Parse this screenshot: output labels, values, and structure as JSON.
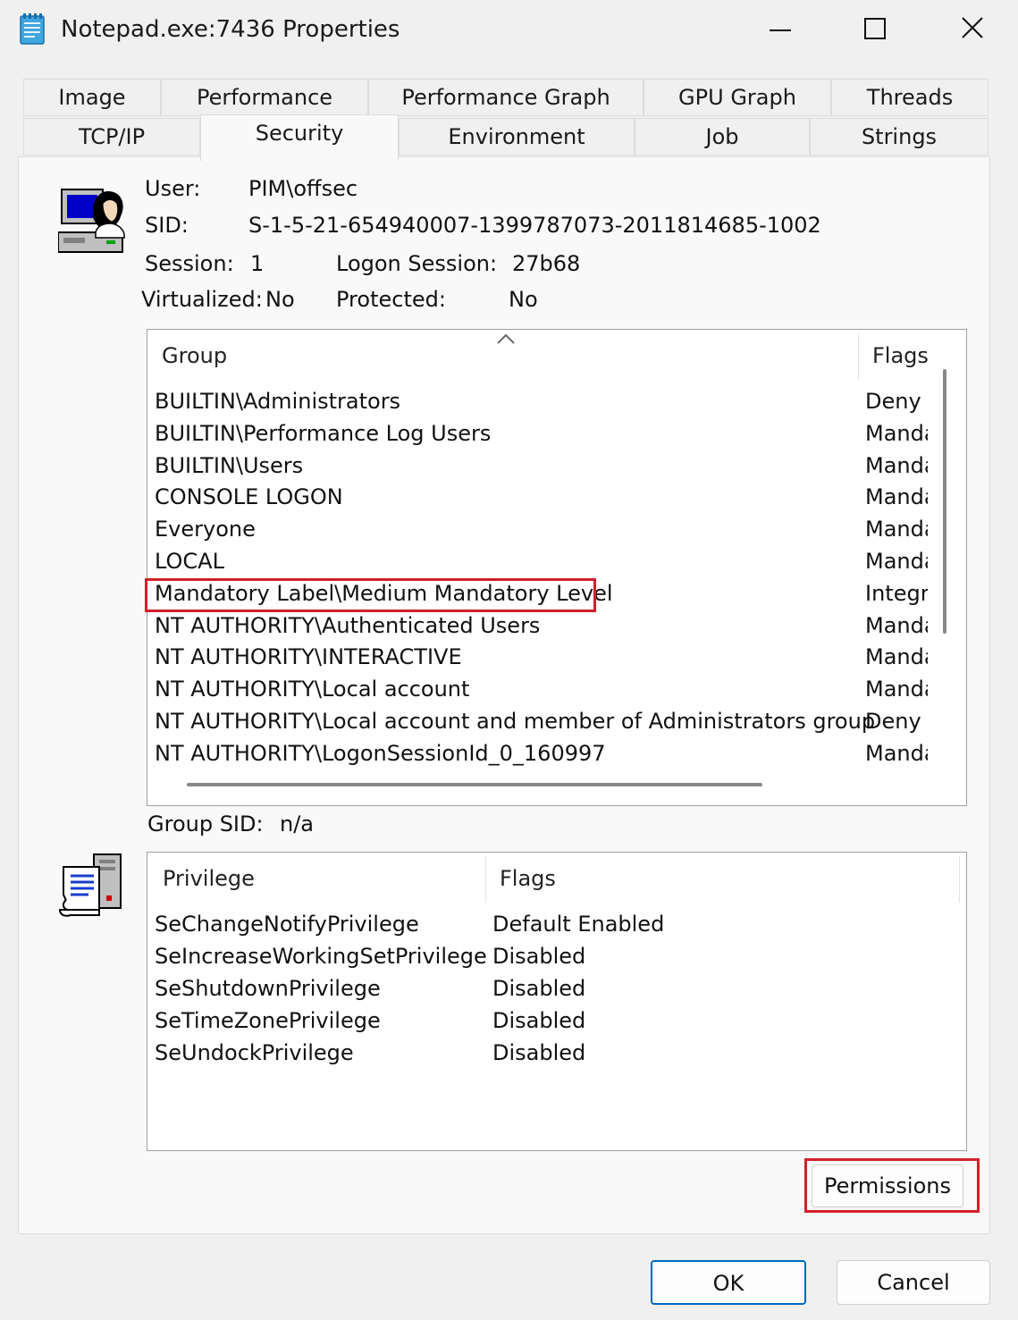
{
  "window": {
    "title": "Notepad.exe:7436 Properties"
  },
  "tabs": {
    "row1": [
      "Image",
      "Performance",
      "Performance Graph",
      "GPU Graph",
      "Threads"
    ],
    "row2": [
      "TCP/IP",
      "Security",
      "Environment",
      "Job",
      "Strings"
    ],
    "active": "Security"
  },
  "identity": {
    "user_label": "User:",
    "user_value": "PIM\\offsec",
    "sid_label": "SID:",
    "sid_value": "S-1-5-21-654940007-1399787073-2011814685-1002",
    "session_label": "Session:",
    "session_value": "1",
    "logon_session_label": "Logon Session:",
    "logon_session_value": "27b68",
    "virtualized_label": "Virtualized:",
    "virtualized_value": "No",
    "protected_label": "Protected:",
    "protected_value": "No"
  },
  "groups": {
    "columns": [
      "Group",
      "Flags"
    ],
    "rows": [
      {
        "group": "BUILTIN\\Administrators",
        "flags": "Deny"
      },
      {
        "group": "BUILTIN\\Performance Log Users",
        "flags": "Manda"
      },
      {
        "group": "BUILTIN\\Users",
        "flags": "Manda"
      },
      {
        "group": "CONSOLE LOGON",
        "flags": "Manda"
      },
      {
        "group": "Everyone",
        "flags": "Manda"
      },
      {
        "group": "LOCAL",
        "flags": "Manda"
      },
      {
        "group": "Mandatory Label\\Medium Mandatory Level",
        "flags": "Integri"
      },
      {
        "group": "NT AUTHORITY\\Authenticated Users",
        "flags": "Manda"
      },
      {
        "group": "NT AUTHORITY\\INTERACTIVE",
        "flags": "Manda"
      },
      {
        "group": "NT AUTHORITY\\Local account",
        "flags": "Manda"
      },
      {
        "group": "NT AUTHORITY\\Local account and member of Administrators group",
        "flags": "Deny"
      },
      {
        "group": "NT AUTHORITY\\LogonSessionId_0_160997",
        "flags": "Manda"
      }
    ]
  },
  "group_sid": {
    "label": "Group SID:",
    "value": "n/a"
  },
  "privileges": {
    "columns": [
      "Privilege",
      "Flags"
    ],
    "rows": [
      {
        "privilege": "SeChangeNotifyPrivilege",
        "flags": "Default Enabled"
      },
      {
        "privilege": "SeIncreaseWorkingSetPrivilege",
        "flags": "Disabled"
      },
      {
        "privilege": "SeShutdownPrivilege",
        "flags": "Disabled"
      },
      {
        "privilege": "SeTimeZonePrivilege",
        "flags": "Disabled"
      },
      {
        "privilege": "SeUndockPrivilege",
        "flags": "Disabled"
      }
    ]
  },
  "buttons": {
    "permissions": "Permissions",
    "ok": "OK",
    "cancel": "Cancel"
  },
  "colors": {
    "highlight": "#d0202a",
    "accent": "#0067c0"
  },
  "icons": [
    "notepad-icon",
    "minimize-icon",
    "maximize-icon",
    "close-icon",
    "user-computer-icon",
    "privilege-icon",
    "sort-up-icon"
  ]
}
